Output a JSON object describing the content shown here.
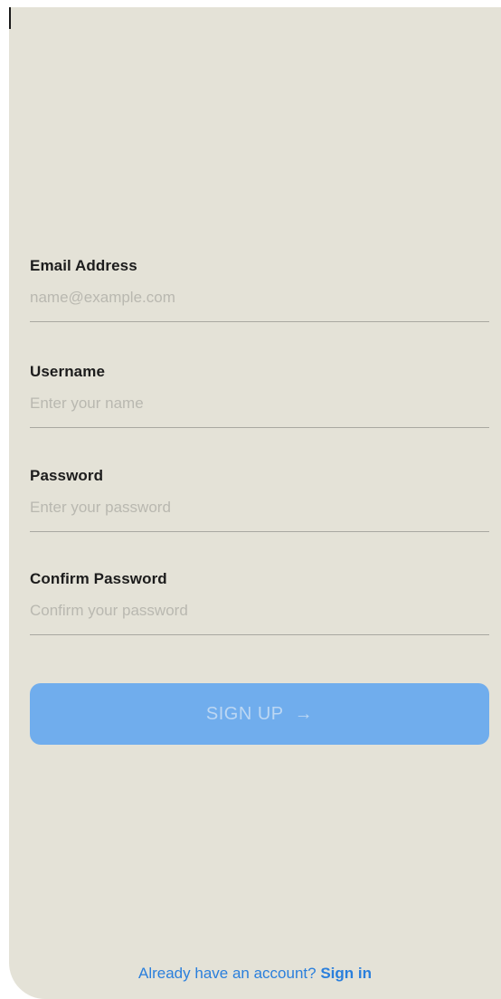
{
  "form": {
    "email": {
      "label": "Email Address",
      "placeholder": "name@example.com",
      "value": ""
    },
    "username": {
      "label": "Username",
      "placeholder": "Enter your name",
      "value": ""
    },
    "password": {
      "label": "Password",
      "placeholder": "Enter your password",
      "value": ""
    },
    "confirm_password": {
      "label": "Confirm Password",
      "placeholder": "Confirm your password",
      "value": ""
    }
  },
  "signup_button": {
    "label": "SIGN UP",
    "icon": "arrow-right-icon",
    "arrow_glyph": "→"
  },
  "footer": {
    "prompt": "Already have an account?",
    "link": "Sign in"
  },
  "colors": {
    "background": "#e4e2d7",
    "accent": "#2a7fdc",
    "button": "#70aded"
  }
}
